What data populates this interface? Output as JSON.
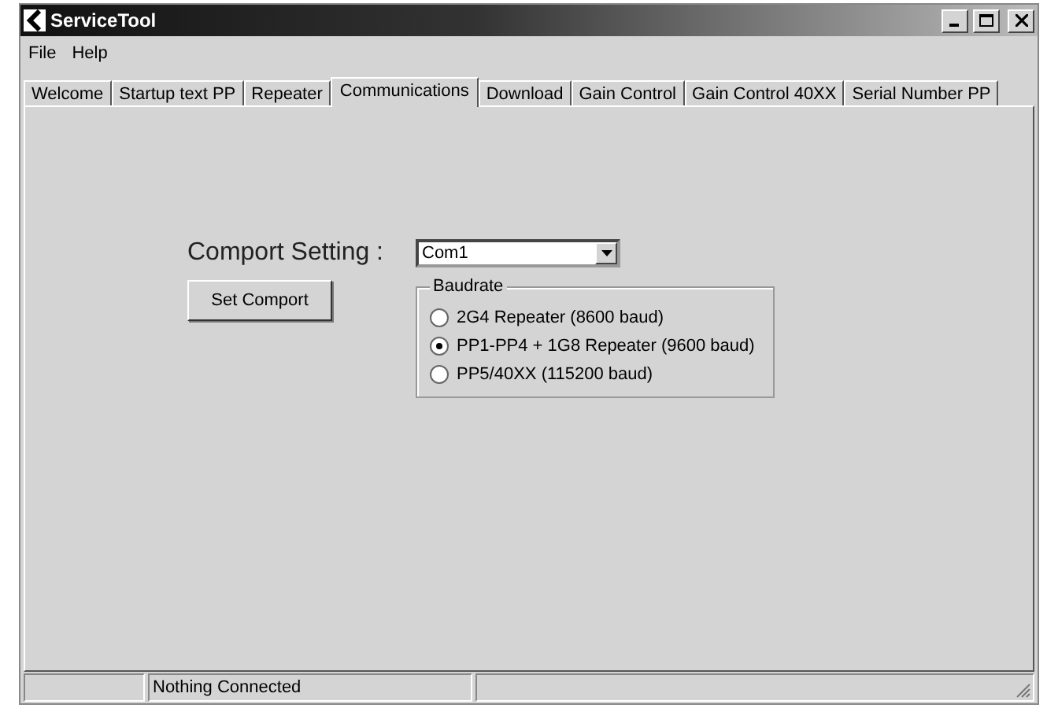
{
  "window": {
    "title": "ServiceTool"
  },
  "menu": [
    "File",
    "Help"
  ],
  "tabs": [
    {
      "label": "Welcome",
      "selected": false
    },
    {
      "label": "Startup text PP",
      "selected": false
    },
    {
      "label": "Repeater",
      "selected": false
    },
    {
      "label": "Communications",
      "selected": true
    },
    {
      "label": "Download",
      "selected": false
    },
    {
      "label": "Gain Control",
      "selected": false
    },
    {
      "label": "Gain Control 40XX",
      "selected": false
    },
    {
      "label": "Serial Number PP",
      "selected": false
    }
  ],
  "comport": {
    "label": "Comport Setting :",
    "value": "Com1",
    "button": "Set Comport"
  },
  "baudrate": {
    "title": "Baudrate",
    "options": [
      {
        "label": "2G4 Repeater (8600 baud)",
        "selected": false
      },
      {
        "label": "PP1-PP4 + 1G8 Repeater (9600 baud)",
        "selected": true
      },
      {
        "label": "PP5/40XX (115200 baud)",
        "selected": false
      }
    ]
  },
  "status_bar": {
    "message": "Nothing Connected"
  }
}
